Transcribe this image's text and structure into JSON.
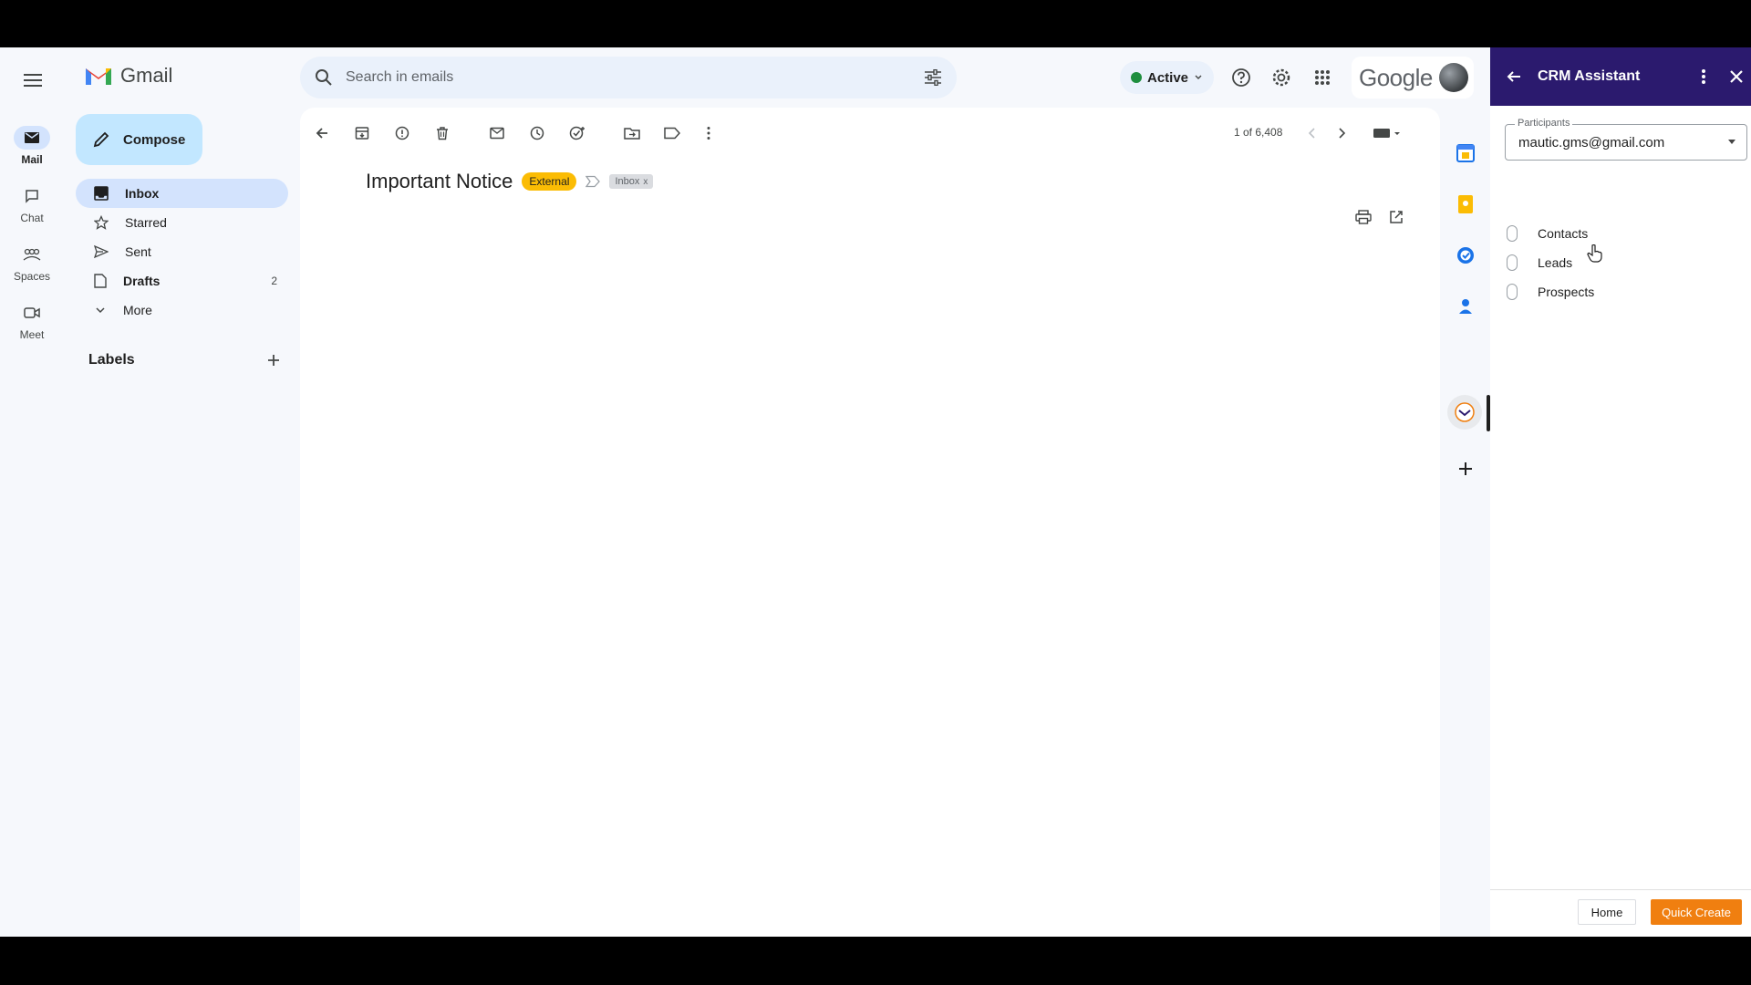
{
  "rail": {
    "items": [
      {
        "label": "Mail"
      },
      {
        "label": "Chat"
      },
      {
        "label": "Spaces"
      },
      {
        "label": "Meet"
      }
    ]
  },
  "app": {
    "name": "Gmail"
  },
  "compose": {
    "label": "Compose"
  },
  "nav": {
    "items": [
      {
        "label": "Inbox",
        "count": ""
      },
      {
        "label": "Starred",
        "count": ""
      },
      {
        "label": "Sent",
        "count": ""
      },
      {
        "label": "Drafts",
        "count": "2"
      },
      {
        "label": "More",
        "count": ""
      }
    ]
  },
  "labels": {
    "title": "Labels"
  },
  "search": {
    "placeholder": "Search in emails"
  },
  "status": {
    "label": "Active",
    "color": "#1e8e3e"
  },
  "account": {
    "brand": "Google"
  },
  "pager": {
    "text": "1 of 6,408"
  },
  "message": {
    "subject": "Important Notice",
    "badge_external": "External",
    "badge_inbox": "Inbox",
    "badge_inbox_close": "x"
  },
  "crm": {
    "title": "CRM Assistant",
    "participants_label": "Participants",
    "participants_value": "mautic.gms@gmail.com",
    "options": [
      {
        "label": "Contacts"
      },
      {
        "label": "Leads"
      },
      {
        "label": "Prospects"
      }
    ],
    "home_button": "Home",
    "quick_create_button": "Quick Create",
    "header_color": "#2b1a6e",
    "accent_color": "#f07f10"
  }
}
